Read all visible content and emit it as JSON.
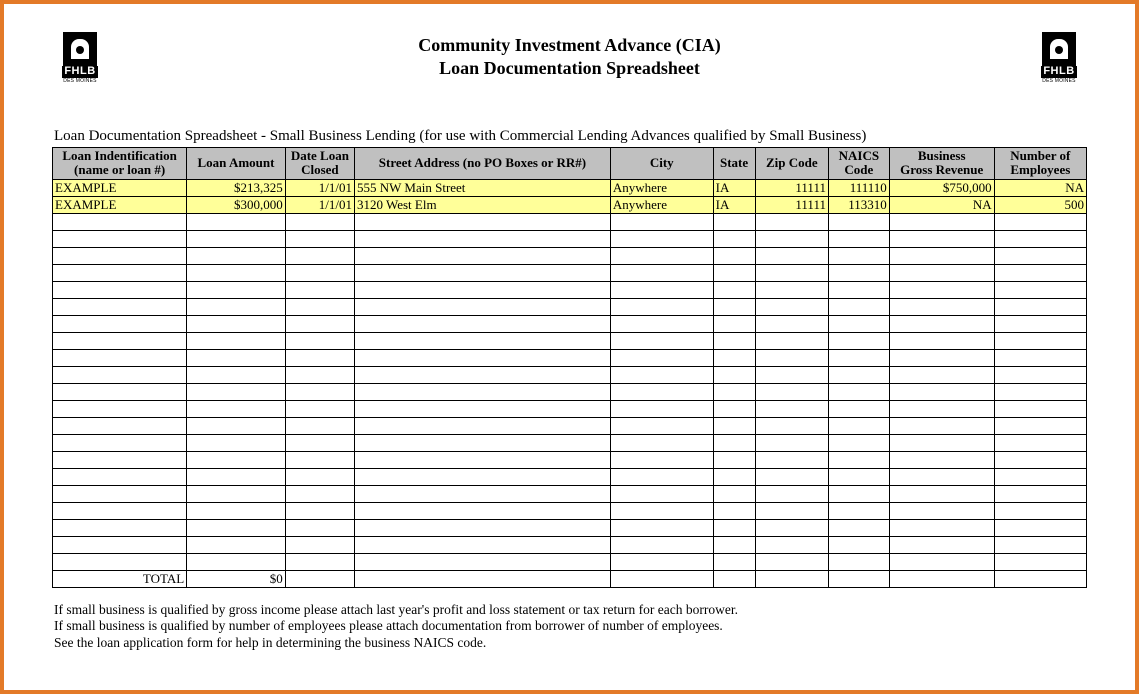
{
  "logo": {
    "brand": "FHLB",
    "sub": "DES MOINES"
  },
  "title": {
    "line1": "Community Investment Advance (CIA)",
    "line2": "Loan Documentation Spreadsheet"
  },
  "subtitle": "Loan Documentation Spreadsheet - Small Business Lending (for use with Commercial Lending Advances qualified by Small Business)",
  "columns": [
    "Loan Indentification (name or loan #)",
    "Loan Amount",
    "Date Loan Closed",
    "Street Address (no PO Boxes or RR#)",
    "City",
    "State",
    "Zip Code",
    "NAICS Code",
    "Business Gross Revenue",
    "Number of Employees"
  ],
  "rows": [
    {
      "loan": "EXAMPLE",
      "amount": "$213,325",
      "date": "1/1/01",
      "street": "555 NW Main Street",
      "city": "Anywhere",
      "state": "IA",
      "zip": "11111",
      "naics": "111110",
      "revenue": "$750,000",
      "employees": "NA"
    },
    {
      "loan": "EXAMPLE",
      "amount": "$300,000",
      "date": "1/1/01",
      "street": "3120 West Elm",
      "city": "Anywhere",
      "state": "IA",
      "zip": "11111",
      "naics": "113310",
      "revenue": "NA",
      "employees": "500"
    }
  ],
  "empty_rows": 21,
  "total": {
    "label": "TOTAL",
    "amount": "$0"
  },
  "notes": [
    "If small business is qualified by gross income please attach last year's profit and loss statement or tax return for each borrower.",
    "If small business is qualified by number of employees please attach documentation from borrower of number of employees.",
    "See the loan application form for help in determining the business NAICS code."
  ]
}
